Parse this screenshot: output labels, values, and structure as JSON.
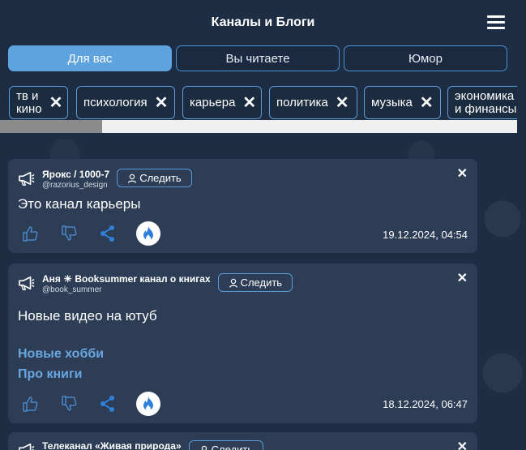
{
  "header": {
    "title": "Каналы и Блоги"
  },
  "tabs": [
    {
      "label": "Для вас",
      "active": true
    },
    {
      "label": "Вы читаете",
      "active": false
    },
    {
      "label": "Юмор",
      "active": false
    }
  ],
  "chips": [
    {
      "label": "тв и\nкино"
    },
    {
      "label": "психология"
    },
    {
      "label": "карьера"
    },
    {
      "label": "политика"
    },
    {
      "label": "музыка"
    },
    {
      "label": "экономика\nи финансы"
    }
  ],
  "chip_close_glyph": "✕",
  "posts": [
    {
      "author": "Ярокс / 1000-7",
      "handle": "@razorius_design",
      "follow_label": "Следить",
      "text": "Это канал карьеры",
      "links": [],
      "date": "19.12.2024, 04:54"
    },
    {
      "author": "Аня ☀ Booksummer канал о книгах",
      "handle": "@book_summer",
      "follow_label": "Следить",
      "text": "Новые видео на ютуб",
      "links": [
        "Новые хобби",
        "Про книги"
      ],
      "date": "18.12.2024, 06:47"
    },
    {
      "author": "Телеканал «Живая природа»",
      "handle": "",
      "follow_label": "Следить",
      "text": "",
      "links": [],
      "date": ""
    }
  ],
  "close_glyph": "✕",
  "colors": {
    "accent": "#5da3df",
    "card": "#2c3d55",
    "background": "#1d2d44",
    "link": "#6aa7e2",
    "icon_blue": "#2f80d8"
  }
}
